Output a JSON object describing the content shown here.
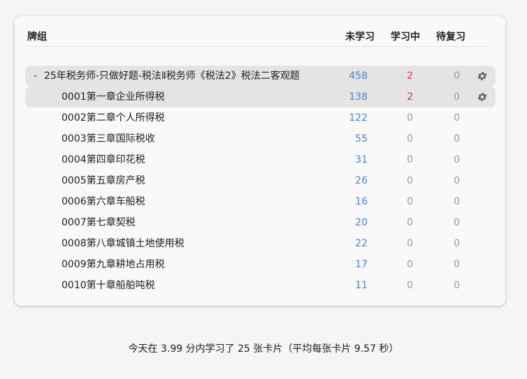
{
  "header": {
    "deck_label": "牌组",
    "new_label": "未学习",
    "learn_label": "学习中",
    "review_label": "待复习"
  },
  "parent": {
    "collapse": "-",
    "name": "25年税务师-只做好题-税法Ⅱ税务师《税法2》税法二客观题",
    "new": "458",
    "learn": "2",
    "review": "0",
    "gear_icon": "gear-icon"
  },
  "children": [
    {
      "name": "0001第一章企业所得税",
      "new": "138",
      "learn": "2",
      "review": "0"
    },
    {
      "name": "0002第二章个人所得税",
      "new": "122",
      "learn": "0",
      "review": "0"
    },
    {
      "name": "0003第三章国际税收",
      "new": "55",
      "learn": "0",
      "review": "0"
    },
    {
      "name": "0004第四章印花税",
      "new": "31",
      "learn": "0",
      "review": "0"
    },
    {
      "name": "0005第五章房产税",
      "new": "26",
      "learn": "0",
      "review": "0"
    },
    {
      "name": "0006第六章车船税",
      "new": "16",
      "learn": "0",
      "review": "0"
    },
    {
      "name": "0007第七章契税",
      "new": "20",
      "learn": "0",
      "review": "0"
    },
    {
      "name": "0008第八章城镇土地使用税",
      "new": "22",
      "learn": "0",
      "review": "0"
    },
    {
      "name": "0009第九章耕地占用税",
      "new": "17",
      "learn": "0",
      "review": "0"
    },
    {
      "name": "0010第十章船舶吨税",
      "new": "11",
      "learn": "0",
      "review": "0"
    }
  ],
  "footer": {
    "text": "今天在 3.99 分内学习了 25 张卡片（平均每张卡片 9.57 秒）"
  },
  "colors": {
    "new": "#4f7fd6",
    "learn_active": "#d23a3a",
    "zero": "#999999",
    "highlight": "#e4e4e4"
  }
}
